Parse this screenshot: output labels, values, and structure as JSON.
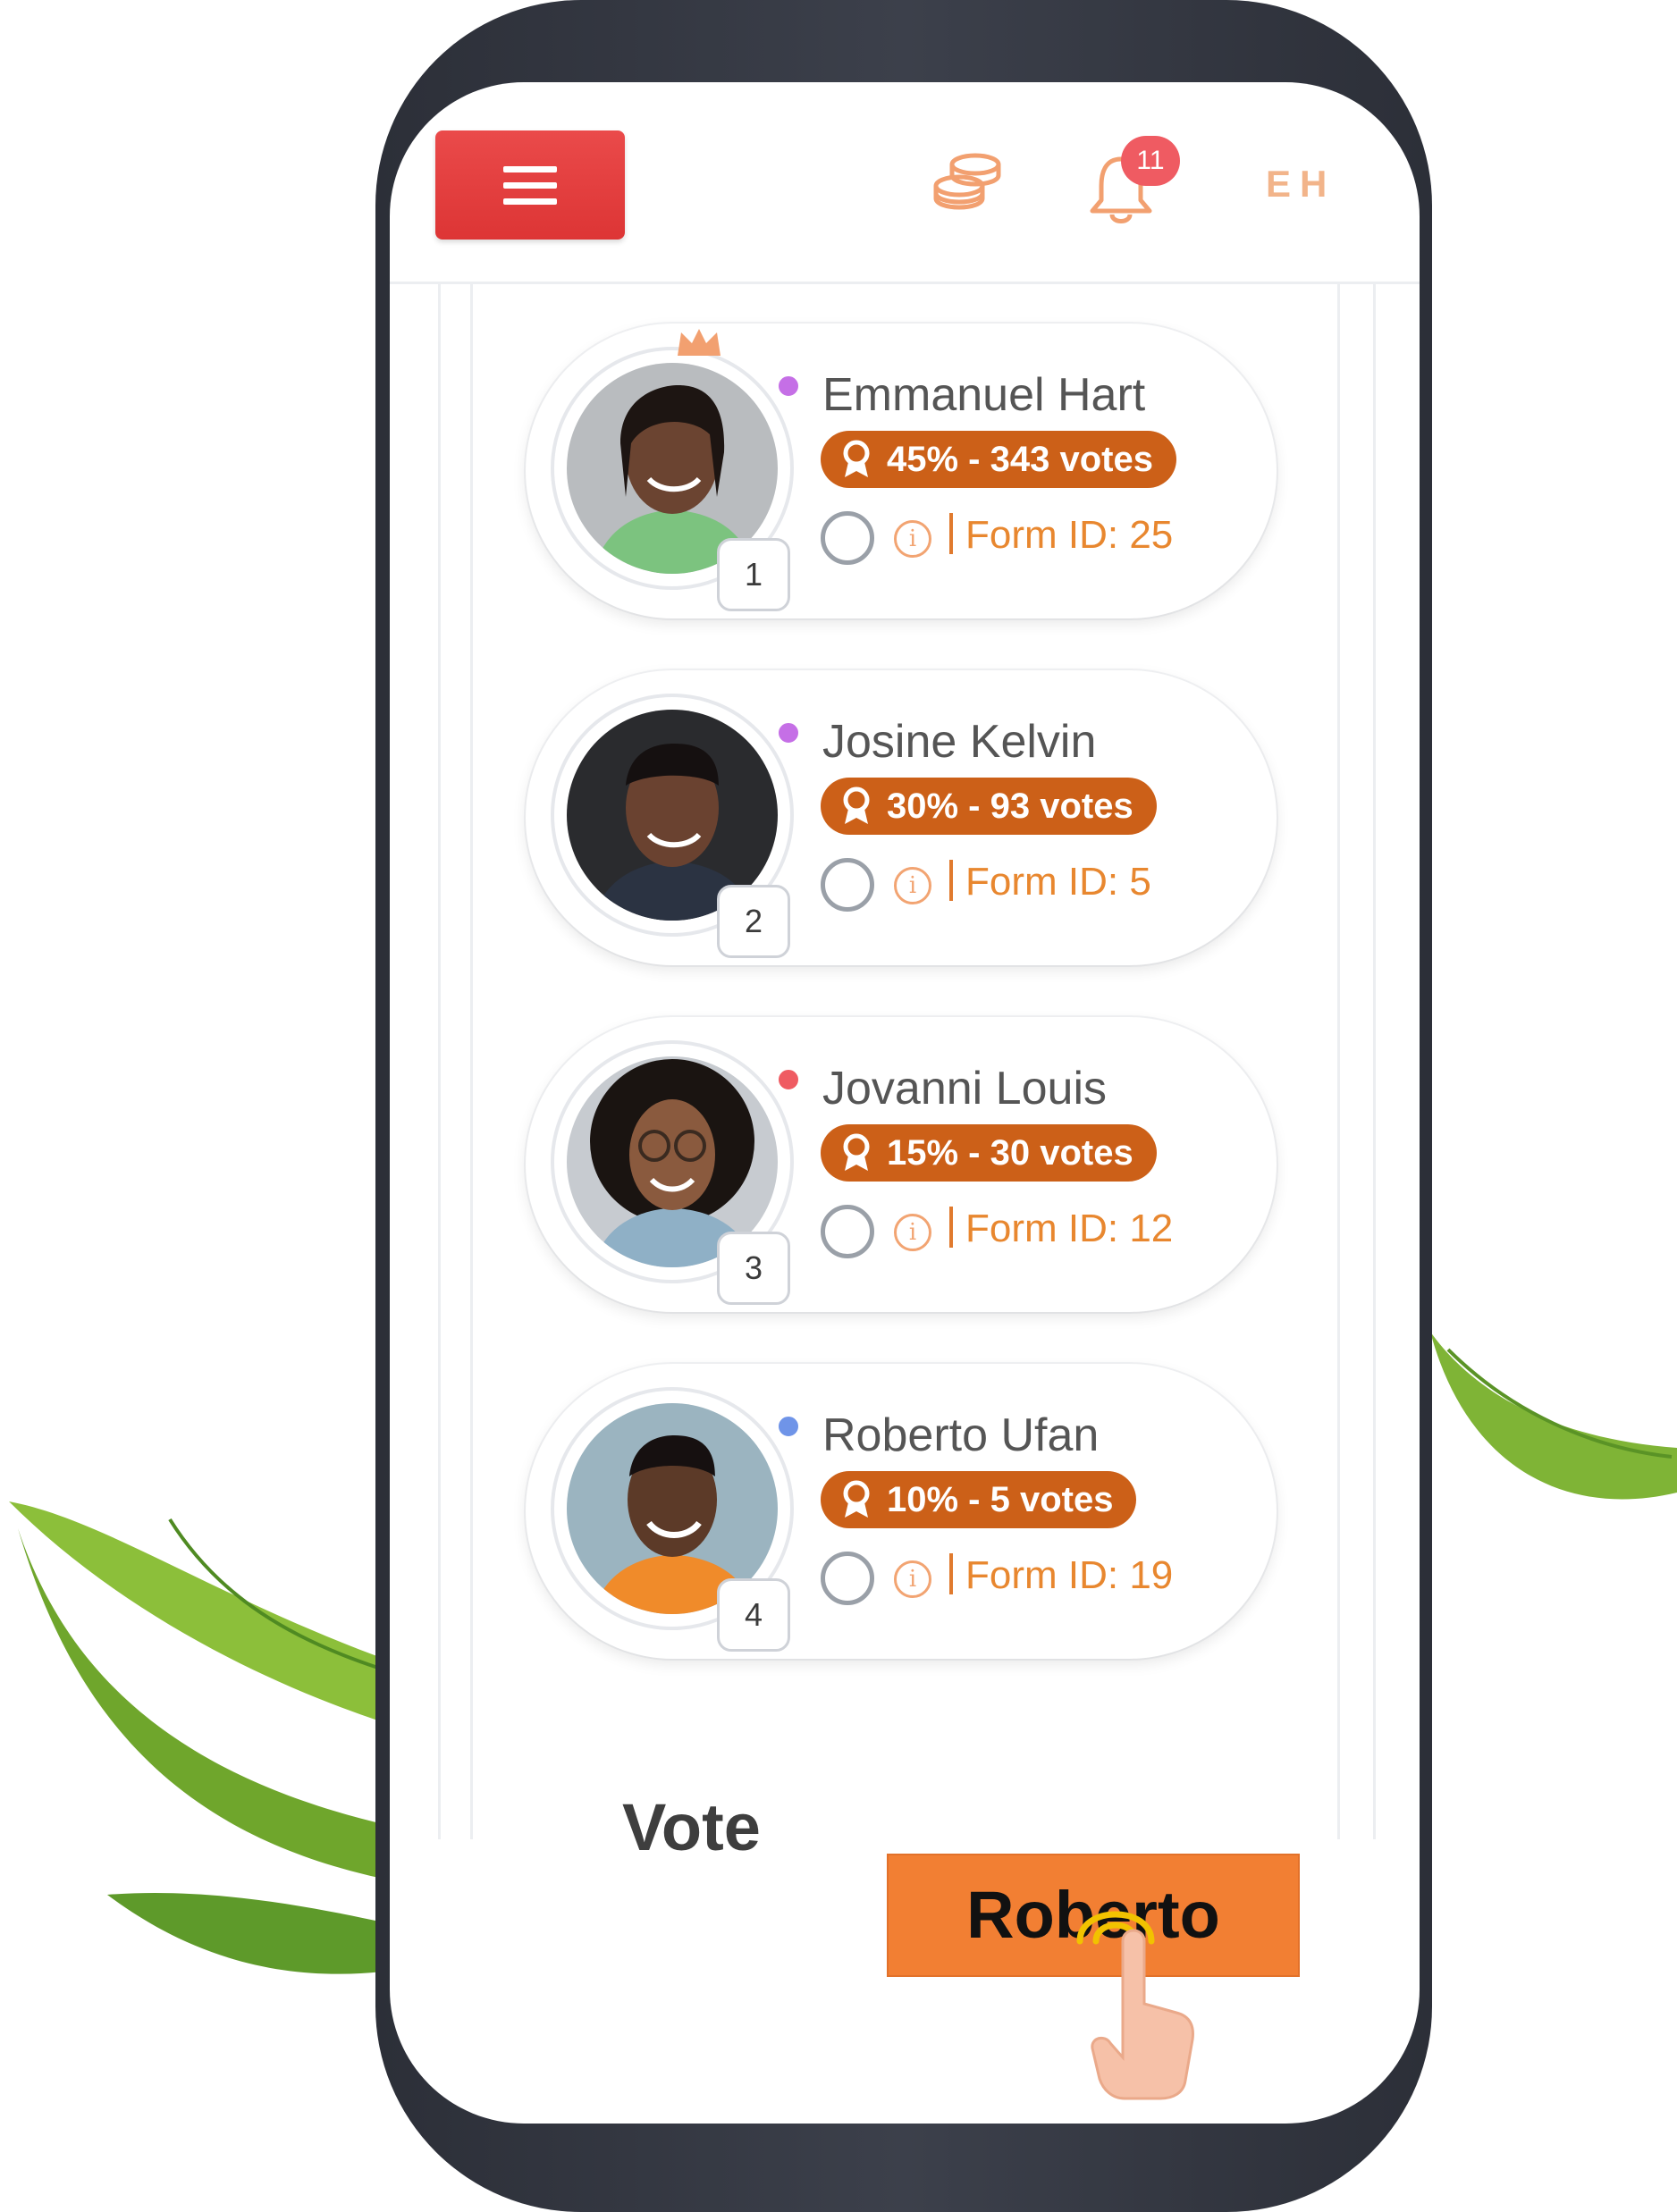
{
  "header": {
    "menu_icon": "hamburger-icon",
    "coins_icon": "coins-stack-icon",
    "bell_icon": "bell-icon",
    "notification_count": "11",
    "user_initials": "EH"
  },
  "candidates": [
    {
      "name": "Emmanuel Hart",
      "votes_text": "45% - 343 votes",
      "form_id": "Form ID: 25",
      "rank": "1",
      "status_color": "#c56fe6",
      "crown": true
    },
    {
      "name": "Josine Kelvin",
      "votes_text": "30% - 93 votes",
      "form_id": "Form ID: 5",
      "rank": "2",
      "status_color": "#c56fe6",
      "crown": false
    },
    {
      "name": "Jovanni Louis",
      "votes_text": "15% - 30 votes",
      "form_id": "Form ID: 12",
      "rank": "3",
      "status_color": "#ef5b62",
      "crown": false
    },
    {
      "name": "Roberto Ufan",
      "votes_text": "10% - 5 votes",
      "form_id": "Form ID: 19",
      "rank": "4",
      "status_color": "#6f94e8",
      "crown": false
    }
  ],
  "footer": {
    "vote_label": "Vote",
    "selected_candidate": "Roberto"
  },
  "colors": {
    "accent_orange": "#f27f33",
    "pill_orange": "#cc6018",
    "menu_red": "#e23e3e",
    "badge_red": "#ef5b62"
  }
}
